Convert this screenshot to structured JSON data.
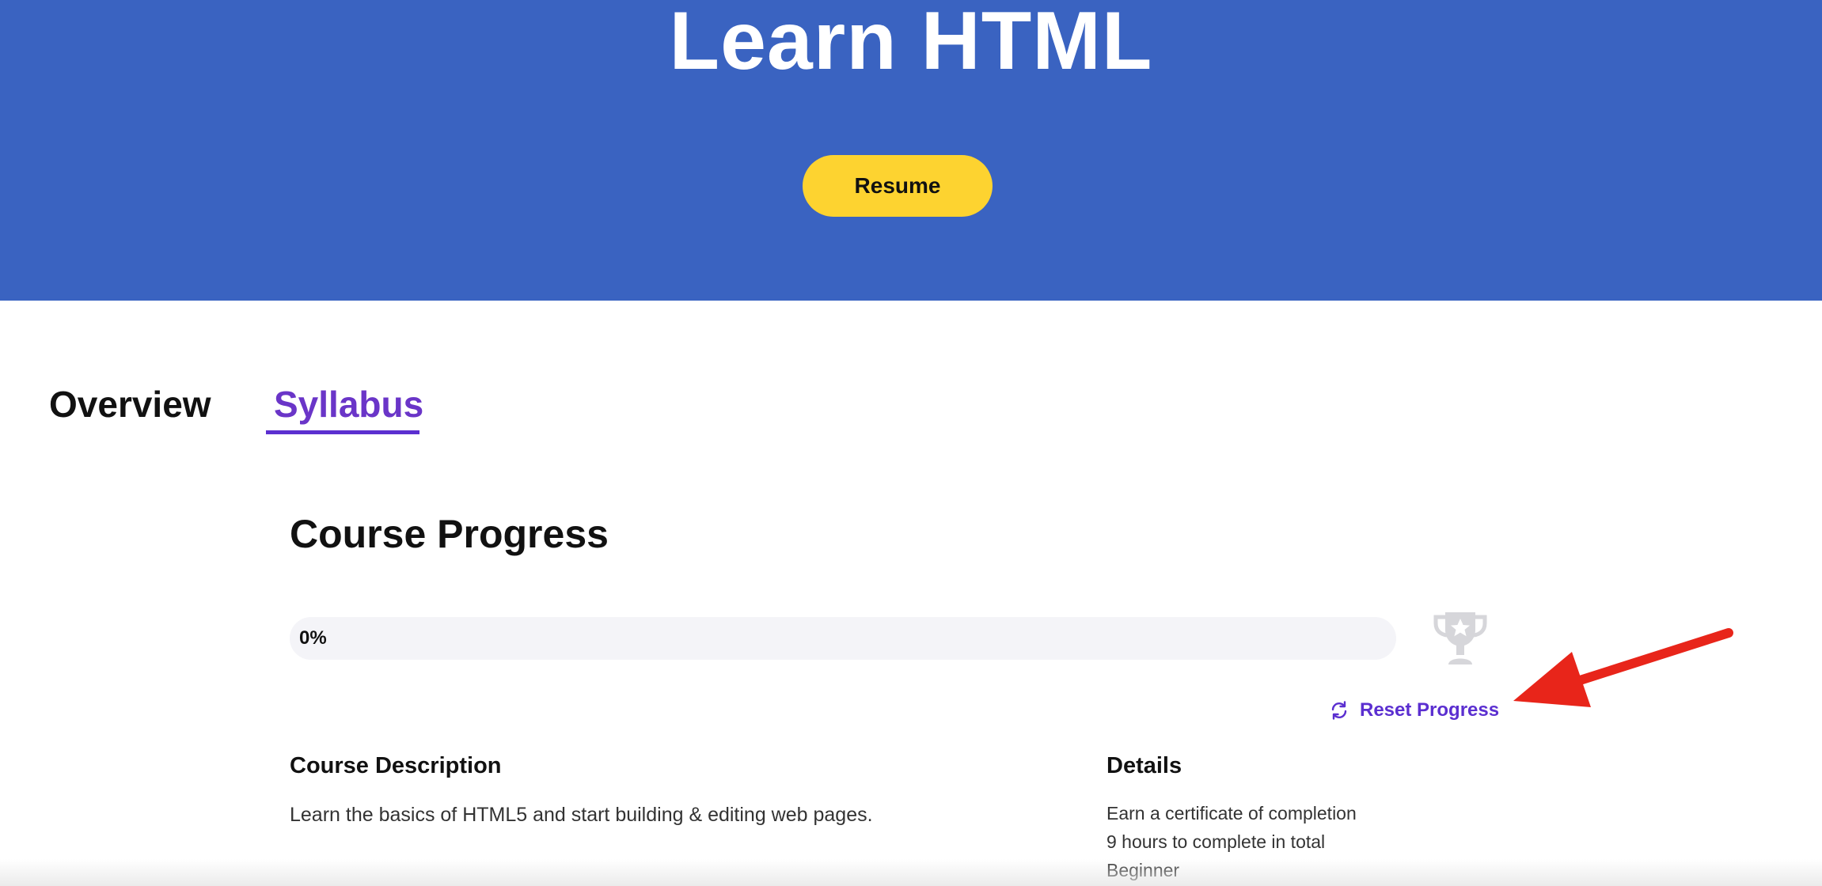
{
  "hero": {
    "title": "Learn HTML",
    "resume_label": "Resume",
    "background_color": "#3a63c1",
    "button_color": "#fdd330"
  },
  "tabs": [
    {
      "label": "Overview",
      "active": false
    },
    {
      "label": "Syllabus",
      "active": true
    }
  ],
  "progress": {
    "title": "Course Progress",
    "percent_label": "0%",
    "percent_value": 0,
    "trophy_icon": "trophy-icon",
    "reset_label": "Reset Progress",
    "reset_icon": "refresh-icon",
    "accent_color": "#5b2fd0"
  },
  "description": {
    "heading": "Course Description",
    "text": "Learn the basics of HTML5 and start building & editing web pages."
  },
  "details": {
    "heading": "Details",
    "items": [
      "Earn a certificate of completion",
      "9 hours to complete in total",
      "Beginner"
    ]
  },
  "annotation": {
    "arrow_icon": "red-arrow-icon",
    "arrow_color": "#e8251a"
  }
}
